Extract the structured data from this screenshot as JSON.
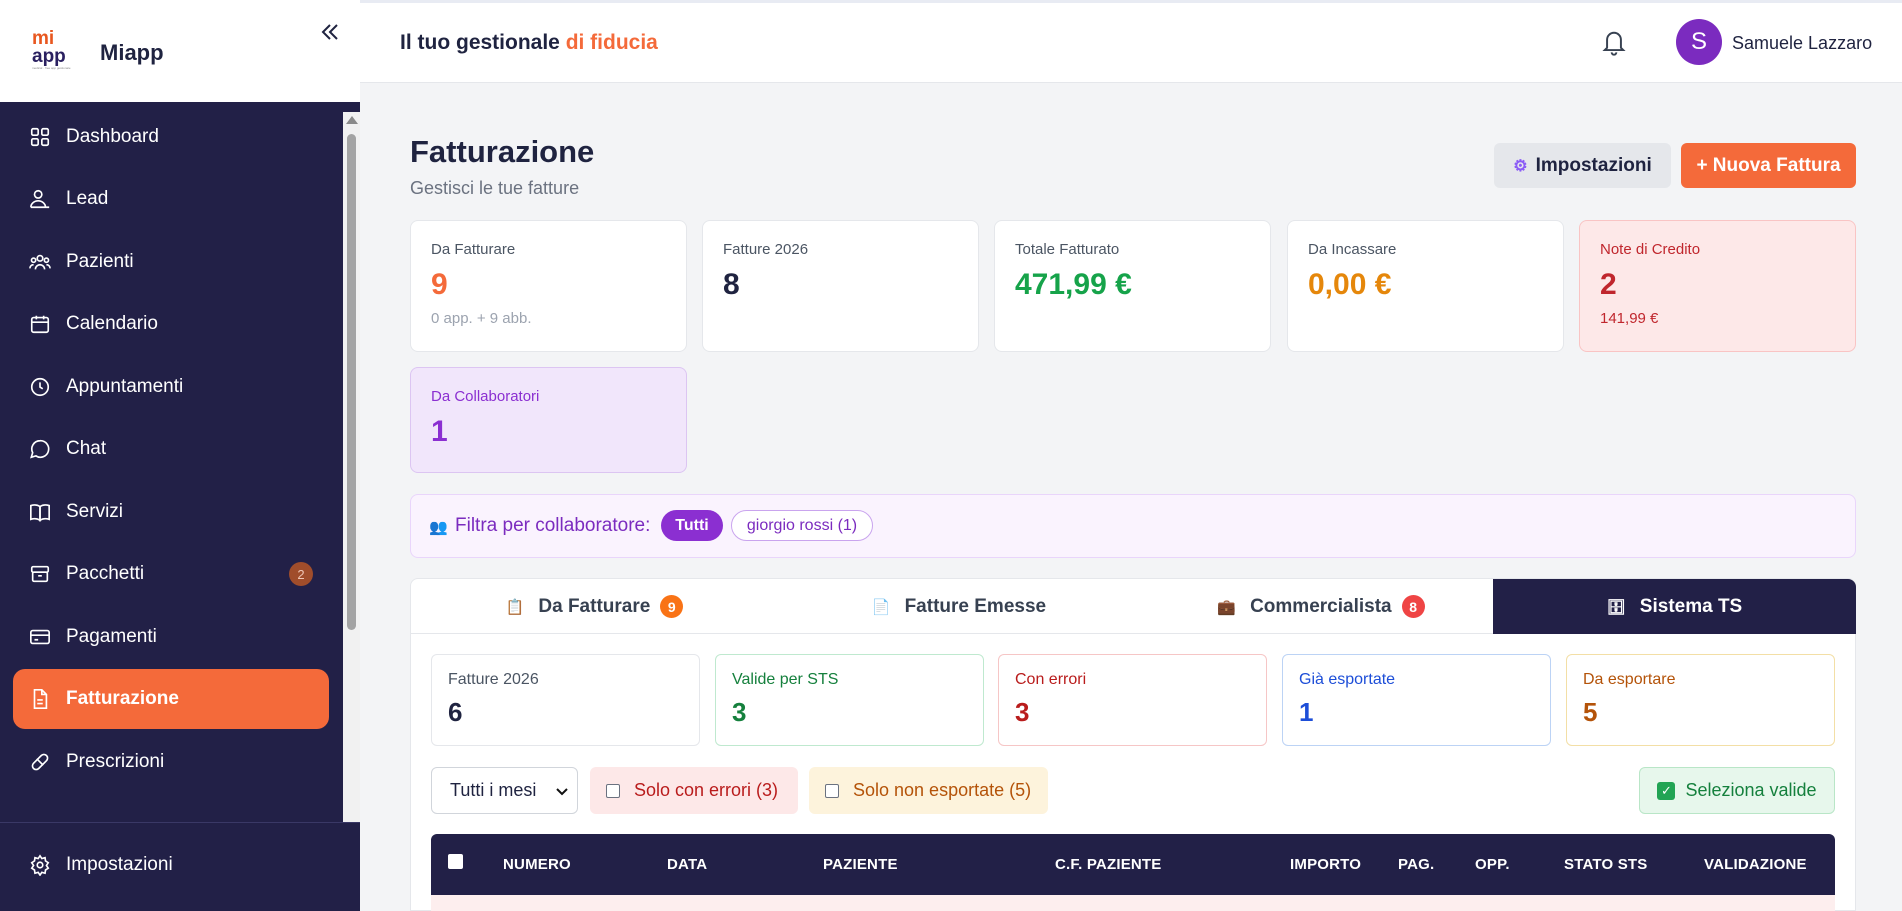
{
  "app": {
    "logo_line1": "mi",
    "logo_line2": "app",
    "logo_small": "medical · free app gestionale",
    "name": "Miapp"
  },
  "sidebar": {
    "items": [
      {
        "label": "Dashboard",
        "icon": "grid-icon"
      },
      {
        "label": "Lead",
        "icon": "person-icon"
      },
      {
        "label": "Pazienti",
        "icon": "users-icon"
      },
      {
        "label": "Calendario",
        "icon": "calendar-icon"
      },
      {
        "label": "Appuntamenti",
        "icon": "clock-icon"
      },
      {
        "label": "Chat",
        "icon": "chat-icon"
      },
      {
        "label": "Servizi",
        "icon": "book-icon"
      },
      {
        "label": "Pacchetti",
        "icon": "package-icon",
        "badge": "2"
      },
      {
        "label": "Pagamenti",
        "icon": "card-icon"
      },
      {
        "label": "Fatturazione",
        "icon": "document-icon",
        "active": true
      },
      {
        "label": "Prescrizioni",
        "icon": "pill-icon"
      }
    ],
    "bottom": {
      "label": "Impostazioni",
      "icon": "gear-icon"
    }
  },
  "header": {
    "tagline_prefix": "Il tuo gestionale ",
    "tagline_accent": "di fiducia",
    "user_initial": "S",
    "user_name": "Samuele Lazzaro"
  },
  "page": {
    "title": "Fatturazione",
    "subtitle": "Gestisci le tue fatture",
    "settings_button": "Impostazioni",
    "new_button": "+ Nuova Fattura"
  },
  "stats": [
    {
      "label": "Da Fatturare",
      "value": "9",
      "sub": "0 app. + 9 abb.",
      "color": "#f46a3a"
    },
    {
      "label": "Fatture 2026",
      "value": "8",
      "color": "#1f2340"
    },
    {
      "label": "Totale Fatturato",
      "value": "471,99 €",
      "color": "#16a34a"
    },
    {
      "label": "Da Incassare",
      "value": "0,00 €",
      "color": "#e5870b"
    },
    {
      "label": "Note di Credito",
      "value": "2",
      "sub": "141,99 €",
      "color": "#c0262d"
    },
    {
      "label": "Da Collaboratori",
      "value": "1",
      "color": "#8b2fd1"
    }
  ],
  "filter": {
    "label": "Filtra per collaboratore:",
    "chip_all": "Tutti",
    "chip_other": "giorgio rossi (1)"
  },
  "tabs": [
    {
      "label": "Da Fatturare",
      "badge": "9",
      "badge_color": "#f97316",
      "icon": "clipboard-icon"
    },
    {
      "label": "Fatture Emesse",
      "icon": "file-icon"
    },
    {
      "label": "Commercialista",
      "badge": "8",
      "badge_color": "#ef4444",
      "icon": "briefcase-icon"
    },
    {
      "label": "Sistema TS",
      "icon": "server-icon",
      "active": true
    }
  ],
  "ts_stats": [
    {
      "label": "Fatture 2026",
      "value": "6",
      "color": "#1f2340",
      "label_color": "#4b5563",
      "border": "#e5e7eb"
    },
    {
      "label": "Valide per STS",
      "value": "3",
      "color": "#15803d",
      "label_color": "#15803d",
      "border": "#bfe9cf"
    },
    {
      "label": "Con errori",
      "value": "3",
      "color": "#b91c1c",
      "label_color": "#b91c1c",
      "border": "#f6c6c6"
    },
    {
      "label": "Già esportate",
      "value": "1",
      "color": "#1d4ed8",
      "label_color": "#1d4ed8",
      "border": "#bcd3f5"
    },
    {
      "label": "Da esportare",
      "value": "5",
      "color": "#b45309",
      "label_color": "#b45309",
      "border": "#f3dfa6"
    }
  ],
  "controls": {
    "month_select": "Tutti i mesi",
    "only_errors": "Solo con errori (3)",
    "only_not_exported": "Solo non esportate (5)",
    "select_valid": "Seleziona valide"
  },
  "table": {
    "columns": [
      "NUMERO",
      "DATA",
      "PAZIENTE",
      "C.F. PAZIENTE",
      "IMPORTO",
      "PAG.",
      "OPP.",
      "STATO STS",
      "VALIDAZIONE"
    ]
  }
}
